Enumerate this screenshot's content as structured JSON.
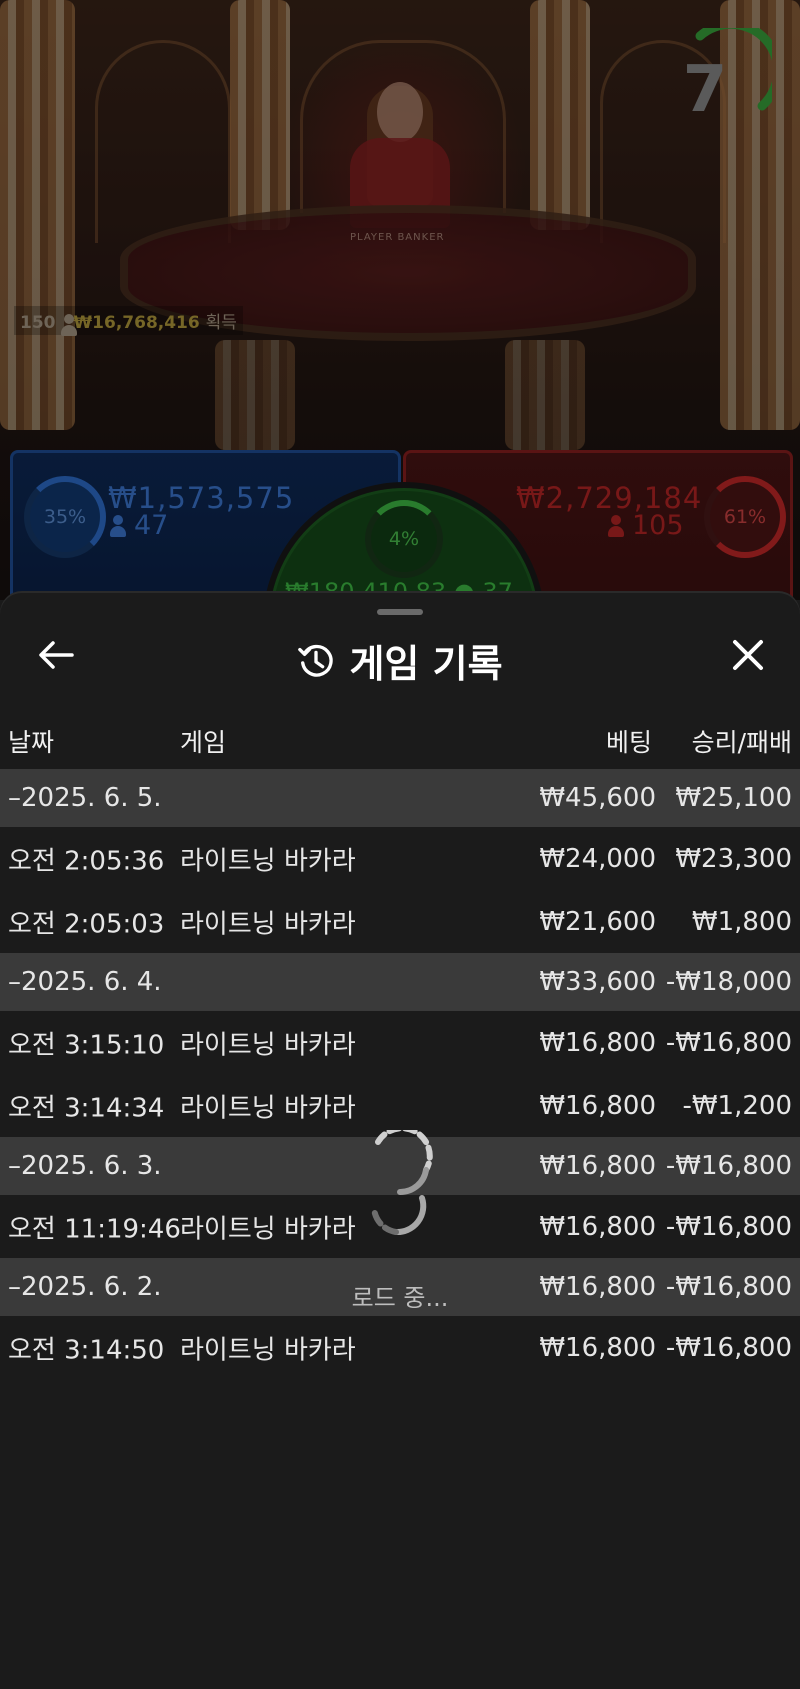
{
  "stream": {
    "players": "150",
    "payout": "₩16,768,416",
    "payout_suffix": "획득",
    "countdown": "7",
    "table_labels": "PLAYER   BANKER"
  },
  "bets": {
    "player": {
      "percent": "35%",
      "amount": "₩1,573,575",
      "count": "47",
      "color": "#3d79d4"
    },
    "banker": {
      "percent": "61%",
      "amount": "₩2,729,184",
      "count": "105",
      "color": "#b82525"
    },
    "tie": {
      "percent": "4%",
      "summary": "₩180,410.83 ● 37",
      "color": "#3fbf46"
    }
  },
  "sheet": {
    "title": "게임 기록",
    "back_icon": "arrow-left-icon",
    "history_icon": "history-icon",
    "close_icon": "close-icon",
    "columns": {
      "date": "날짜",
      "game": "게임",
      "bet": "베팅",
      "result": "승리/패배"
    },
    "groups": [
      {
        "date": "–2025. 6. 5.",
        "bet": "₩45,600",
        "result": "₩25,100",
        "items": [
          {
            "time": "오전 2:05:36",
            "game": "라이트닝 바카라",
            "bet": "₩24,000",
            "result": "₩23,300"
          },
          {
            "time": "오전 2:05:03",
            "game": "라이트닝 바카라",
            "bet": "₩21,600",
            "result": "₩1,800"
          }
        ]
      },
      {
        "date": "–2025. 6. 4.",
        "bet": "₩33,600",
        "result": "-₩18,000",
        "items": [
          {
            "time": "오전 3:15:10",
            "game": "라이트닝 바카라",
            "bet": "₩16,800",
            "result": "-₩16,800"
          },
          {
            "time": "오전 3:14:34",
            "game": "라이트닝 바카라",
            "bet": "₩16,800",
            "result": "-₩1,200"
          }
        ]
      },
      {
        "date": "–2025. 6. 3.",
        "bet": "₩16,800",
        "result": "-₩16,800",
        "items": [
          {
            "time": "오전 11:19:46",
            "game": "라이트닝 바카라",
            "bet": "₩16,800",
            "result": "-₩16,800"
          }
        ]
      },
      {
        "date": "–2025. 6. 2.",
        "bet": "₩16,800",
        "result": "-₩16,800",
        "items": [
          {
            "time": "오전 3:14:50",
            "game": "라이트닝 바카라",
            "bet": "₩16,800",
            "result": "-₩16,800"
          }
        ]
      }
    ],
    "loading_text": "로드 중..."
  }
}
